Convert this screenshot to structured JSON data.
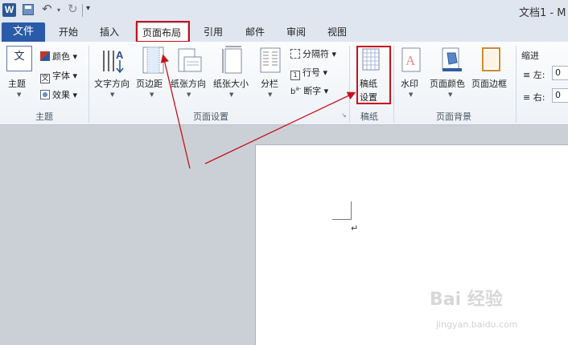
{
  "window": {
    "title": "文档1 - M"
  },
  "qat": {
    "app_letter": "W"
  },
  "tabs": {
    "file": "文件",
    "items": [
      "开始",
      "插入",
      "页面布局",
      "引用",
      "邮件",
      "审阅",
      "视图"
    ]
  },
  "groups": {
    "theme": {
      "label": "主题",
      "main": "主题",
      "theme_icon_text": "文",
      "colors": "颜色",
      "fonts": "字体",
      "effects": "效果"
    },
    "page_setup": {
      "label": "页面设置",
      "text_direction": "文字方向",
      "margins": "页边距",
      "orientation": "纸张方向",
      "size": "纸张大小",
      "columns": "分栏",
      "breaks": "分隔符",
      "line_numbers": "行号",
      "hyphenation": "断字"
    },
    "manuscript": {
      "label": "稿纸",
      "setup_line1": "稿纸",
      "setup_line2": "设置"
    },
    "page_background": {
      "label": "页面背景",
      "watermark": "水印",
      "page_color": "页面颜色",
      "page_borders": "页面边框"
    },
    "paragraph": {
      "indent": "缩进",
      "left_label": "左:",
      "left_value": "0",
      "right_label": "右:",
      "right_value": "0"
    }
  },
  "document": {
    "paragraph_mark": "↵"
  },
  "watermark": {
    "brand": "Bai 经验",
    "url": "jingyan.baidu.com"
  },
  "colors": {
    "file_tab": "#2a5ba8",
    "highlight": "#c8101b"
  }
}
